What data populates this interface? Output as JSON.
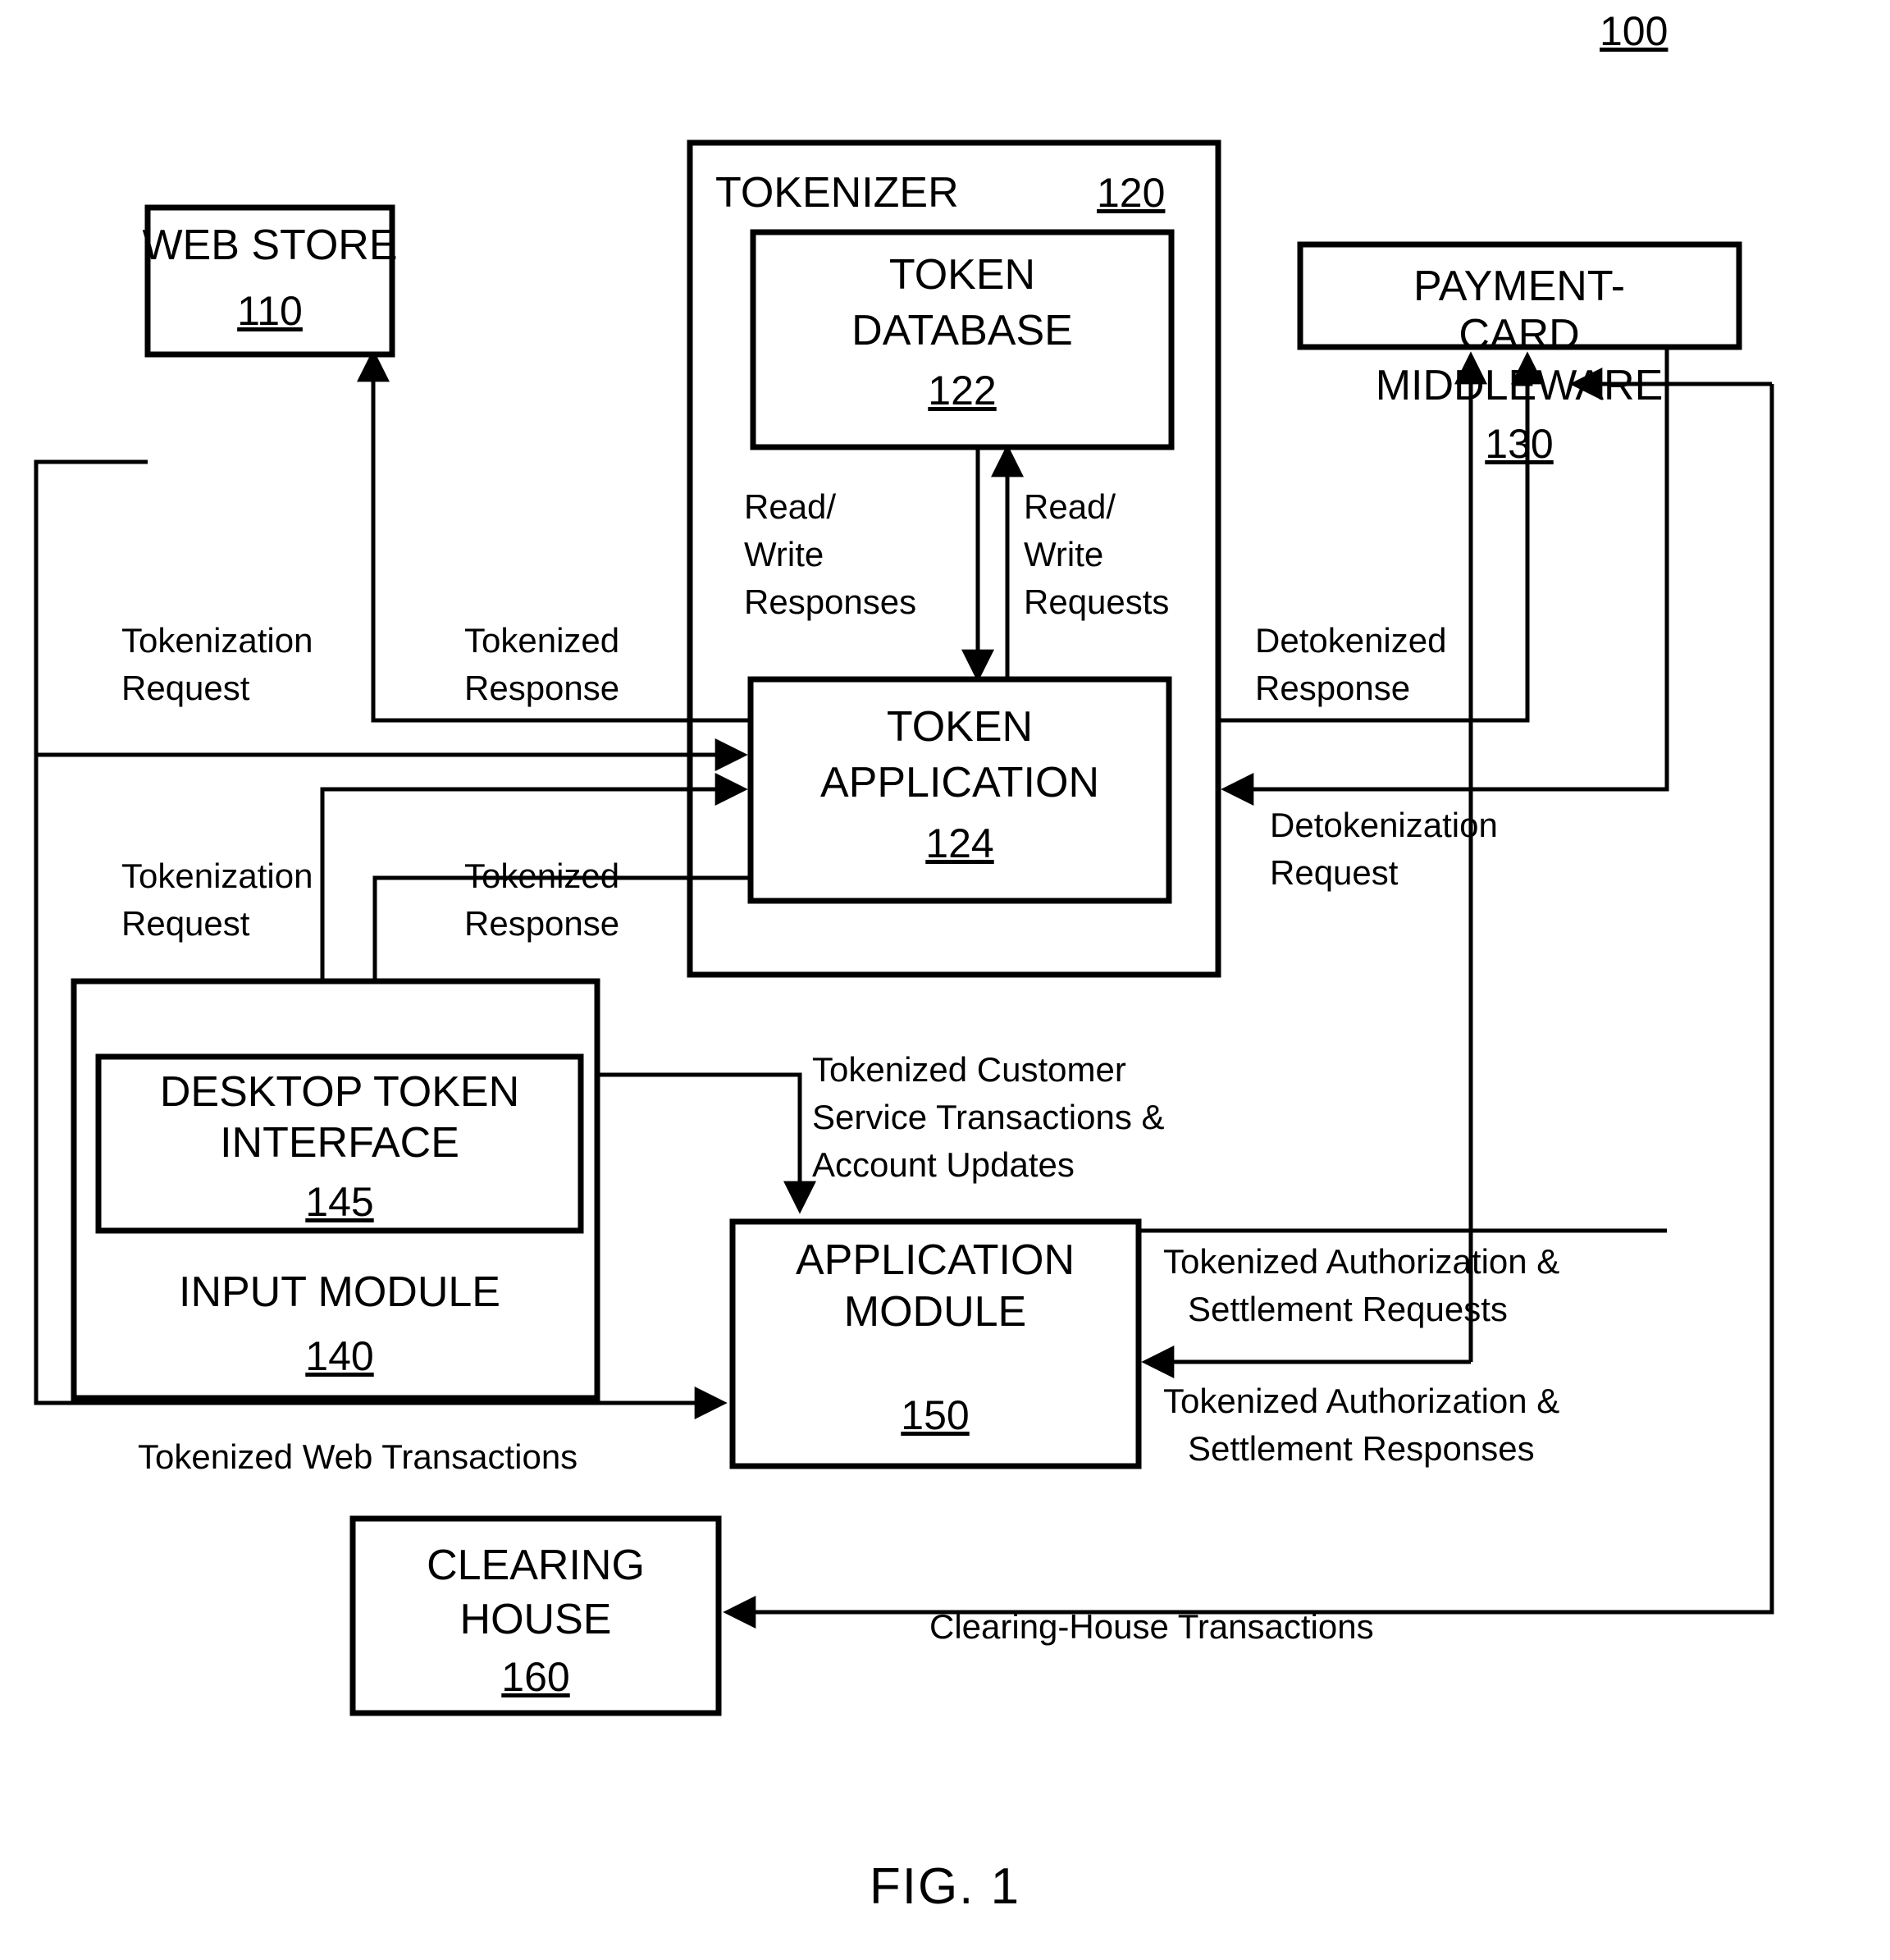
{
  "figure": {
    "reference_numeral": "100",
    "caption": "FIG. 1"
  },
  "blocks": {
    "web_store": {
      "title": "WEB STORE",
      "ref": "110"
    },
    "tokenizer": {
      "title": "TOKENIZER",
      "ref": "120"
    },
    "token_database": {
      "line1": "TOKEN",
      "line2": "DATABASE",
      "ref": "122"
    },
    "token_application": {
      "line1": "TOKEN",
      "line2": "APPLICATION",
      "ref": "124"
    },
    "payment_card_middleware": {
      "line1": "PAYMENT-",
      "line2": "CARD",
      "line3": "MIDDLEWARE",
      "ref": "130"
    },
    "input_module": {
      "title": "INPUT MODULE",
      "ref": "140"
    },
    "desktop_token_interface": {
      "line1": "DESKTOP TOKEN",
      "line2": "INTERFACE",
      "ref": "145"
    },
    "application_module": {
      "line1": "APPLICATION",
      "line2": "MODULE",
      "ref": "150"
    },
    "clearing_house": {
      "line1": "CLEARING",
      "line2": "HOUSE",
      "ref": "160"
    }
  },
  "flows": {
    "read_write_responses": {
      "l1": "Read/",
      "l2": "Write",
      "l3": "Responses"
    },
    "read_write_requests": {
      "l1": "Read/",
      "l2": "Write",
      "l3": "Requests"
    },
    "web_tokenization_request": {
      "l1": "Tokenization",
      "l2": "Request"
    },
    "web_tokenized_response": {
      "l1": "Tokenized",
      "l2": "Response"
    },
    "desktop_tokenization_request": {
      "l1": "Tokenization",
      "l2": "Request"
    },
    "desktop_tokenized_response": {
      "l1": "Tokenized",
      "l2": "Response"
    },
    "detokenized_response": {
      "l1": "Detokenized",
      "l2": "Response"
    },
    "detokenization_request": {
      "l1": "Detokenization",
      "l2": "Request"
    },
    "tokenized_customer_service": {
      "l1": "Tokenized Customer",
      "l2": "Service Transactions &",
      "l3": "Account Updates"
    },
    "tokenized_auth_settlement_requests": {
      "l1": "Tokenized Authorization &",
      "l2": "Settlement Requests"
    },
    "tokenized_auth_settlement_responses": {
      "l1": "Tokenized Authorization &",
      "l2": "Settlement Responses"
    },
    "tokenized_web_transactions": {
      "l1": "Tokenized Web Transactions"
    },
    "clearing_house_transactions": {
      "l1": "Clearing-House Transactions"
    }
  }
}
